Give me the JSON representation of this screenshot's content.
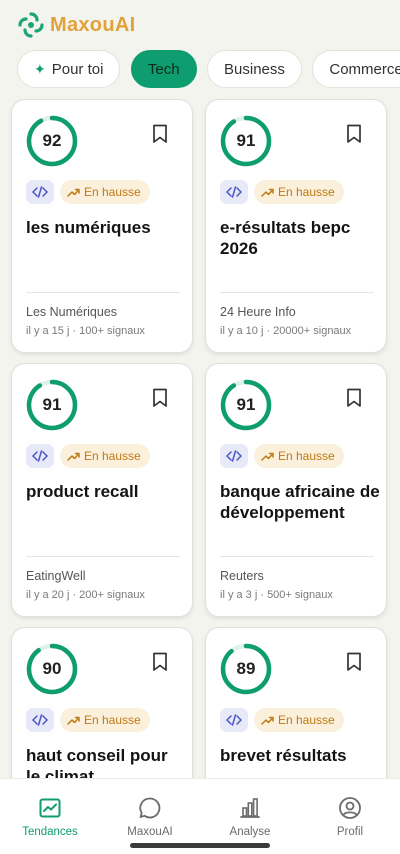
{
  "app": {
    "name": "MaxouAI"
  },
  "colors": {
    "accent": "#0e9d6e",
    "brand": "#e2a23a",
    "trend": "#c07a14"
  },
  "tabs": [
    {
      "label": "Pour toi",
      "icon": "sparkle-icon"
    },
    {
      "label": "Tech"
    },
    {
      "label": "Business"
    },
    {
      "label": "Commerce"
    }
  ],
  "active_tab": "Tech",
  "cards": [
    {
      "score": "92",
      "score_pct": 92,
      "trend": "En hausse",
      "title": "les numériques",
      "source": "Les Numériques",
      "meta": "il y a 15 j · 100+ signaux"
    },
    {
      "score": "91",
      "score_pct": 91,
      "trend": "En hausse",
      "title": "e-résultats bepc 2026",
      "source": "24 Heure Info",
      "meta": "il y a 10 j · 20000+ signaux"
    },
    {
      "score": "91",
      "score_pct": 91,
      "trend": "En hausse",
      "title": "product recall",
      "source": "EatingWell",
      "meta": "il y a 20 j · 200+ signaux"
    },
    {
      "score": "91",
      "score_pct": 91,
      "trend": "En hausse",
      "title": "banque africaine de développement",
      "source": "Reuters",
      "meta": "il y a 3 j · 500+ signaux"
    },
    {
      "score": "90",
      "score_pct": 90,
      "trend": "En hausse",
      "title": "haut conseil pour le climat",
      "source": "",
      "meta": ""
    },
    {
      "score": "89",
      "score_pct": 89,
      "trend": "En hausse",
      "title": "brevet résultats",
      "source": "",
      "meta": ""
    }
  ],
  "nav": [
    {
      "label": "Tendances",
      "icon": "chart-icon"
    },
    {
      "label": "MaxouAI",
      "icon": "chat-bubble-icon"
    },
    {
      "label": "Analyse",
      "icon": "bar-chart-icon"
    },
    {
      "label": "Profil",
      "icon": "user-icon"
    }
  ]
}
